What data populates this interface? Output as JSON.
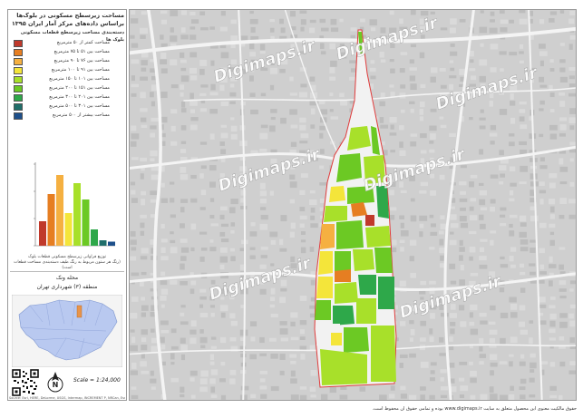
{
  "legend": {
    "title_line1": "مساحت زیرسطح مسکونی در بلوک‌ها",
    "title_line2": "براساس داده‌های مرکز آمار ایران ۱۳۹۵",
    "title_line3": "دسته‌بندی مساحت زیرسطح قطعات مسکونی بلوک ها",
    "items": [
      {
        "label": "مساحت کمتر از ۵۰ مترمربع",
        "color": "#c0392b"
      },
      {
        "label": "مساحت بین ۵۱ تا ۷۵ مترمربع",
        "color": "#e67e22"
      },
      {
        "label": "مساحت بین ۷۶ تا ۹۰ مترمربع",
        "color": "#f5b041"
      },
      {
        "label": "مساحت بین ۹۱ تا ۱۰۰ مترمربع",
        "color": "#f4e53a"
      },
      {
        "label": "مساحت بین ۱۰۱ تا ۱۵۰ مترمربع",
        "color": "#a8e02a"
      },
      {
        "label": "مساحت بین ۱۵۱ تا ۲۰۰ مترمربع",
        "color": "#6cc924"
      },
      {
        "label": "مساحت بین ۲۰۱ تا ۳۰۰ مترمربع",
        "color": "#2ea84a"
      },
      {
        "label": "مساحت بین ۳۰۱ تا ۵۰۰ مترمربع",
        "color": "#1f6e6a"
      },
      {
        "label": "مساحت بیشتر از ۵۰۰ مترمربع",
        "color": "#1d4f8a"
      }
    ],
    "histogram": {
      "values": [
        18,
        38,
        52,
        24,
        46,
        34,
        12,
        4,
        3
      ],
      "max": 60,
      "caption_line1": "توزیع فراوانی زیرسطح مسکونی قطعات بلوک",
      "caption_line2": "(رنگ هر ستون مربوط به رنگ طیف دسته‌بندی مساحت قطعات است)"
    },
    "region_title": "محله ونک",
    "region_subtitle": "منطقه (۳) شهرداری تهران",
    "scale": "Scale = 1:24,000",
    "north": "N",
    "credits": "Source: Esri, HERE, DeLorme, USGS, Intermap, INCREMENT P, NRCan, Esri Japan, METI"
  },
  "watermark": "Digimaps.ir",
  "footer": "حقوق مالکیت معنوی این محصول متعلق به سایت www.digimaps.ir بوده و تمامی حقوق آن محفوظ است.",
  "colors": {
    "basemap": "#cfcfcf",
    "road": "#f4f4f4",
    "boundary": "#e03c3c",
    "highlight": "#e8944a",
    "inset_fill": "#b9c9f0"
  }
}
